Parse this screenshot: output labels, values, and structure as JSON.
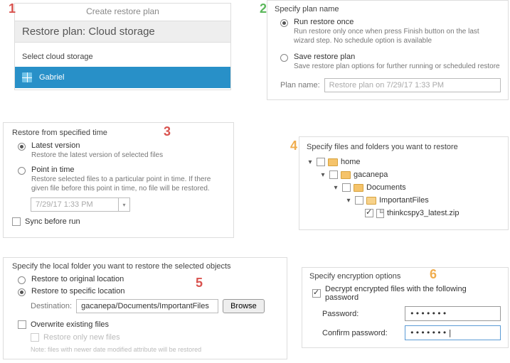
{
  "steps": {
    "s1": "1",
    "s2": "2",
    "s3": "3",
    "s4": "4",
    "s5": "5",
    "s6": "6"
  },
  "panel1": {
    "create_label": "Create restore plan",
    "title": "Restore plan: Cloud storage",
    "select_label": "Select cloud storage",
    "account_name": "Gabriel"
  },
  "panel2": {
    "title": "Specify plan name",
    "opt1_label": "Run restore once",
    "opt1_desc": "Run restore only once when press Finish button on the last wizard step. No schedule option is available",
    "opt2_label": "Save restore plan",
    "opt2_desc": "Save restore plan options for further running or scheduled restore",
    "plan_name_label": "Plan name:",
    "plan_name_value": "Restore plan on 7/29/17 1:33 PM"
  },
  "panel3": {
    "title": "Restore from specified time",
    "opt1_label": "Latest version",
    "opt1_desc": "Restore the latest version of selected files",
    "opt2_label": "Point in time",
    "opt2_desc": "Restore selected files to a particular point in time. If there given file before this point in time, no file will be restored.",
    "time_value": "7/29/17 1:33 PM",
    "sync_label": "Sync before run"
  },
  "panel4": {
    "title": "Specify files and folders you want to restore",
    "tree": {
      "n0": "home",
      "n1": "gacanepa",
      "n2": "Documents",
      "n3": "ImportantFiles",
      "n4": "thinkcspy3_latest.zip"
    }
  },
  "panel5": {
    "title": "Specify the local folder you want to restore the selected objects",
    "opt1_label": "Restore to original location",
    "opt2_label": "Restore to specific location",
    "dest_label": "Destination:",
    "dest_value": "gacanepa/Documents/ImportantFiles",
    "browse_label": "Browse",
    "overwrite_label": "Overwrite existing files",
    "only_new_label": "Restore only new files",
    "note": "Note: files with newer date modified attribute will be restored"
  },
  "panel6": {
    "title": "Specify encryption options",
    "decrypt_label": "Decrypt encrypted files with the following password",
    "pw_label": "Password:",
    "pw_value": "•••••••",
    "pw2_label": "Confirm password:",
    "pw2_value": "•••••••|"
  }
}
